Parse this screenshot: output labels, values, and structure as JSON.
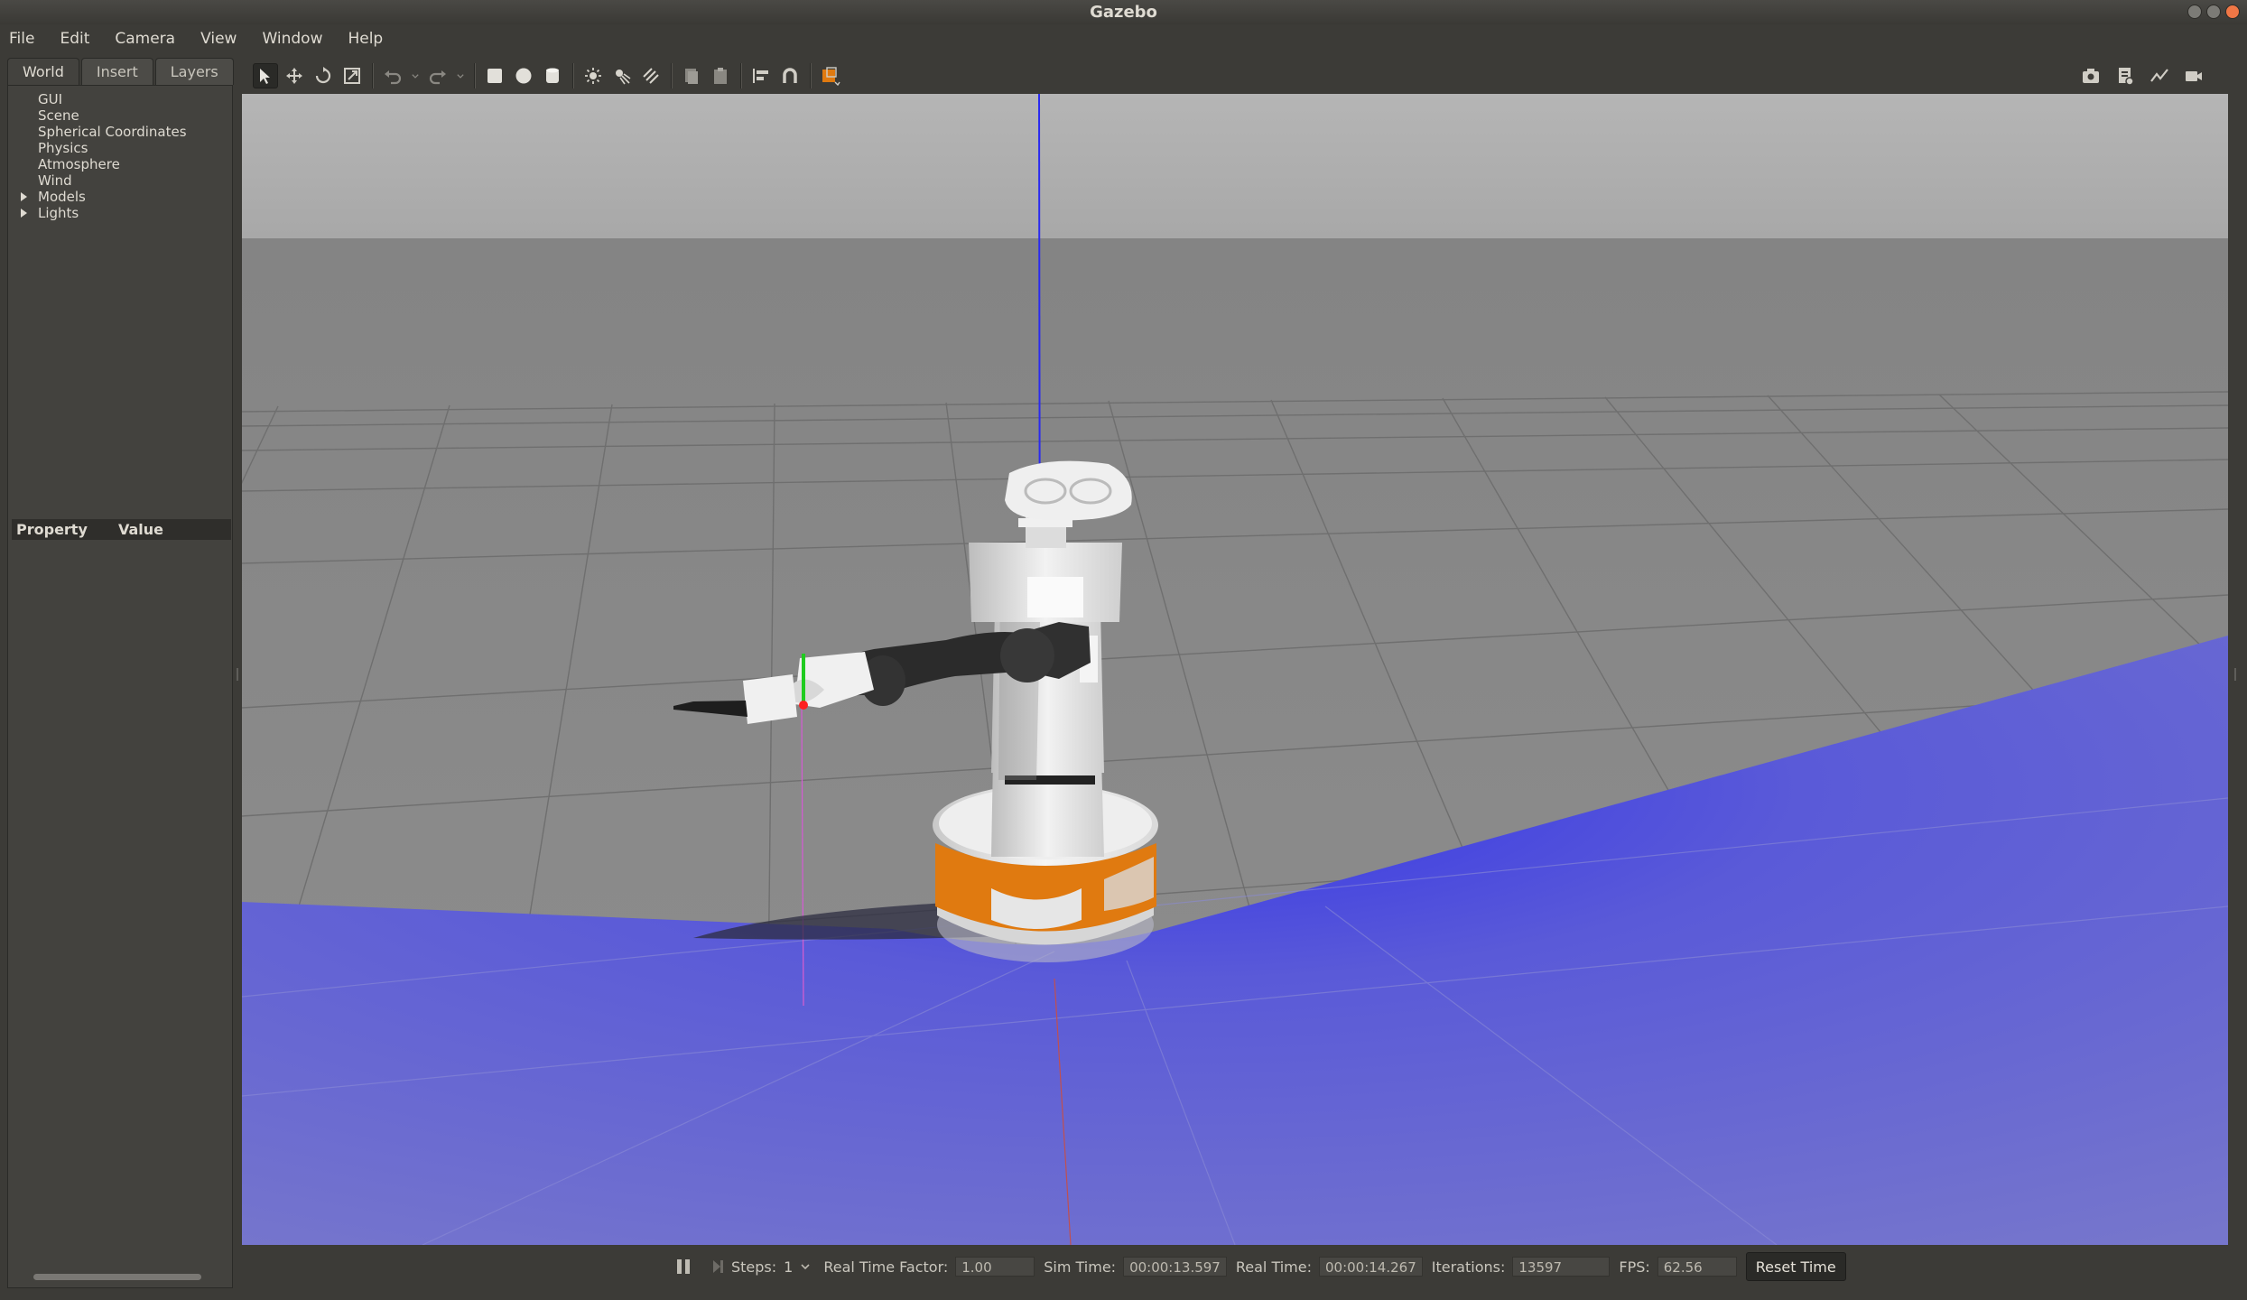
{
  "window": {
    "title": "Gazebo"
  },
  "menu": [
    "File",
    "Edit",
    "Camera",
    "View",
    "Window",
    "Help"
  ],
  "left_panel": {
    "tabs": [
      "World",
      "Insert",
      "Layers"
    ],
    "active_tab": "World",
    "tree": [
      {
        "label": "GUI",
        "expandable": false
      },
      {
        "label": "Scene",
        "expandable": false
      },
      {
        "label": "Spherical Coordinates",
        "expandable": false
      },
      {
        "label": "Physics",
        "expandable": false
      },
      {
        "label": "Atmosphere",
        "expandable": false
      },
      {
        "label": "Wind",
        "expandable": false
      },
      {
        "label": "Models",
        "expandable": true
      },
      {
        "label": "Lights",
        "expandable": true
      }
    ],
    "property_header": {
      "property": "Property",
      "value": "Value"
    }
  },
  "toolbar": {
    "tools": [
      "select-icon",
      "translate-icon",
      "rotate-icon",
      "scale-icon",
      "undo-icon",
      "redo-icon",
      "box-icon",
      "sphere-icon",
      "cylinder-icon",
      "point-light-icon",
      "spot-light-icon",
      "directional-light-icon",
      "copy-icon",
      "paste-icon",
      "align-icon",
      "snap-icon",
      "view-angle-icon"
    ],
    "right_tools": [
      "screenshot-icon",
      "log-icon",
      "plot-icon",
      "video-icon"
    ]
  },
  "status": {
    "steps_label": "Steps:",
    "steps_value": "1",
    "rtf_label": "Real Time Factor:",
    "rtf_value": "1.00",
    "sim_time_label": "Sim Time:",
    "sim_time_value": "00:00:13.597",
    "real_time_label": "Real Time:",
    "real_time_value": "00:00:14.267",
    "iterations_label": "Iterations:",
    "iterations_value": "13597",
    "fps_label": "FPS:",
    "fps_value": "62.56",
    "reset_label": "Reset Time"
  },
  "colors": {
    "laser": "#5a5ad8",
    "robot_accent": "#e07a10",
    "arm": "#2b2b2b",
    "axis_z": "#2020ff",
    "axis_y": "#20cc20",
    "axis_x": "#ff2020"
  }
}
